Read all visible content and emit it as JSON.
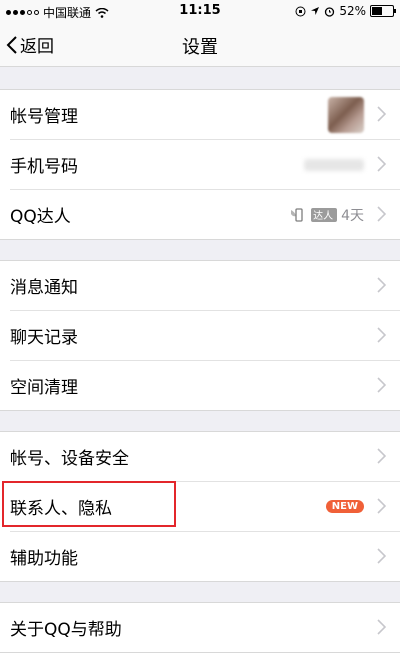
{
  "status": {
    "carrier": "中国联通",
    "time": "11:15",
    "battery": "52%",
    "battery_level": 0.52
  },
  "nav": {
    "back_label": "返回",
    "title": "设置"
  },
  "groups": [
    [
      {
        "label": "帐号管理"
      },
      {
        "label": "手机号码"
      },
      {
        "label": "QQ达人",
        "badge": "达人",
        "value": "4天"
      }
    ],
    [
      {
        "label": "消息通知"
      },
      {
        "label": "聊天记录"
      },
      {
        "label": "空间清理"
      }
    ],
    [
      {
        "label": "帐号、设备安全"
      },
      {
        "label": "联系人、隐私",
        "badge": "NEW"
      },
      {
        "label": "辅助功能"
      }
    ],
    [
      {
        "label": "关于QQ与帮助"
      }
    ]
  ],
  "colors": {
    "accent": "#f06038",
    "highlight": "#e3262b"
  }
}
